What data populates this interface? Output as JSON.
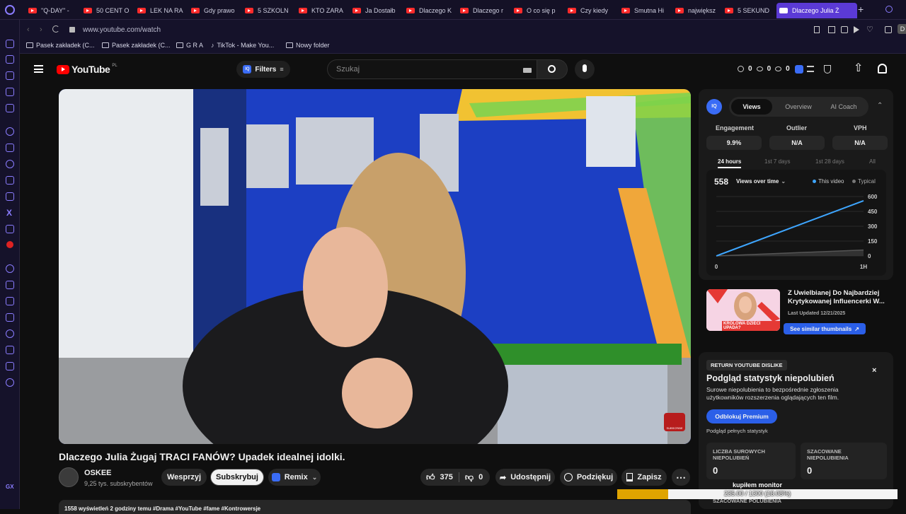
{
  "tabs": [
    {
      "label": "\"Q-DAY\" -"
    },
    {
      "label": "50 CENT O"
    },
    {
      "label": "LEK NA RA"
    },
    {
      "label": "Gdy prawo"
    },
    {
      "label": "5 SZKOLN"
    },
    {
      "label": "KTO ZARA"
    },
    {
      "label": "Ja Dostałb"
    },
    {
      "label": "Dlaczego K"
    },
    {
      "label": "Dlaczego r"
    },
    {
      "label": "O co się p"
    },
    {
      "label": "Czy kiedy"
    },
    {
      "label": "Smutna Hi"
    },
    {
      "label": "największ"
    },
    {
      "label": "5 SEKUND"
    },
    {
      "label": "Dlaczego Julia Ż"
    }
  ],
  "address": {
    "url": "www.youtube.com/watch"
  },
  "bookmarks": [
    {
      "label": "Pasek zakładek (C..."
    },
    {
      "label": "Pasek zakładek (C..."
    },
    {
      "label": "G R A"
    },
    {
      "label": "TikTok - Make You..."
    },
    {
      "label": "Nowy folder"
    }
  ],
  "header": {
    "logo": "YouTube",
    "region": "PL",
    "filters": "Filters",
    "search_placeholder": "Szukaj",
    "counters": [
      "0",
      "0",
      "0"
    ]
  },
  "video": {
    "title": "Dlaczego Julia Żugaj TRACI FANÓW? Upadek idealnej idolki.",
    "channel": "OSKEE",
    "subscribers": "9,25 tys. subskrybentów",
    "support": "Wesprzyj",
    "subscribe": "Subskrybuj",
    "remix": "Remix",
    "likes": "375",
    "dislikes": "0",
    "share": "Udostępnij",
    "thanks": "Podziękuj",
    "save": "Zapisz",
    "subscribe_badge": "SUBSCRIBE"
  },
  "vidiq": {
    "badge": "IQ",
    "tabs": [
      "Views",
      "Overview",
      "AI Coach"
    ],
    "stats": [
      {
        "label": "Engagement",
        "value": "9.9%"
      },
      {
        "label": "Outlier",
        "value": "N/A"
      },
      {
        "label": "VPH",
        "value": "N/A"
      }
    ],
    "ranges": [
      "24 hours",
      "1st 7 days",
      "1st 28 days",
      "All"
    ],
    "views_count": "558",
    "metric_select": "Views over time",
    "legend": [
      "This video",
      "Typical"
    ],
    "colors": {
      "this_video": "#3ea6ff",
      "typical": "#555555",
      "accent": "#3a6cf6"
    }
  },
  "chart_data": {
    "type": "line",
    "x": [
      "0",
      "1H"
    ],
    "series": [
      {
        "name": "This video",
        "values": [
          0,
          558
        ]
      },
      {
        "name": "Typical",
        "values": [
          0,
          60
        ]
      }
    ],
    "yticks": [
      0,
      150,
      300,
      450,
      600
    ],
    "ylim": [
      0,
      600
    ],
    "xlabels": [
      "0",
      "1H"
    ]
  },
  "thumbnail": {
    "title": "Z Uwielbianej Do Najbardziej Krytykowanej Influencerki W...",
    "updated": "Last Updated 12/21/2025",
    "see_similar": "See similar thumbnails",
    "thumb_text": "KRÓLOWA DZIECI UPADA?"
  },
  "ryd": {
    "tag": "RETURN YOUTUBE DISLIKE",
    "heading": "Podgląd statystyk niepolubień",
    "desc": "Surowe niepolubienia to bezpośrednie zgłoszenia użytkowników rozszerzenia oglądających ten film.",
    "unlock": "Odblokuj Premium",
    "full_stats": "Podgląd pełnych statystyk",
    "raw_label": "LICZBA SUROWYCH NIEPOLUBIEŃ",
    "raw_value": "0",
    "est_label": "SZACOWANE NIEPOLUBIENIA",
    "est_value": "0",
    "extra_label": "SZACOWANE POLUBIENIA"
  },
  "overlay": {
    "title": "kupiłem monitor",
    "progress_text": "235.00 / 1300 (18.08%)",
    "progress": 0.1808
  },
  "comments_hint": "1558 wyświetleń  2 godziny temu  #Drama #YouTube #fame #Kontrowersje"
}
